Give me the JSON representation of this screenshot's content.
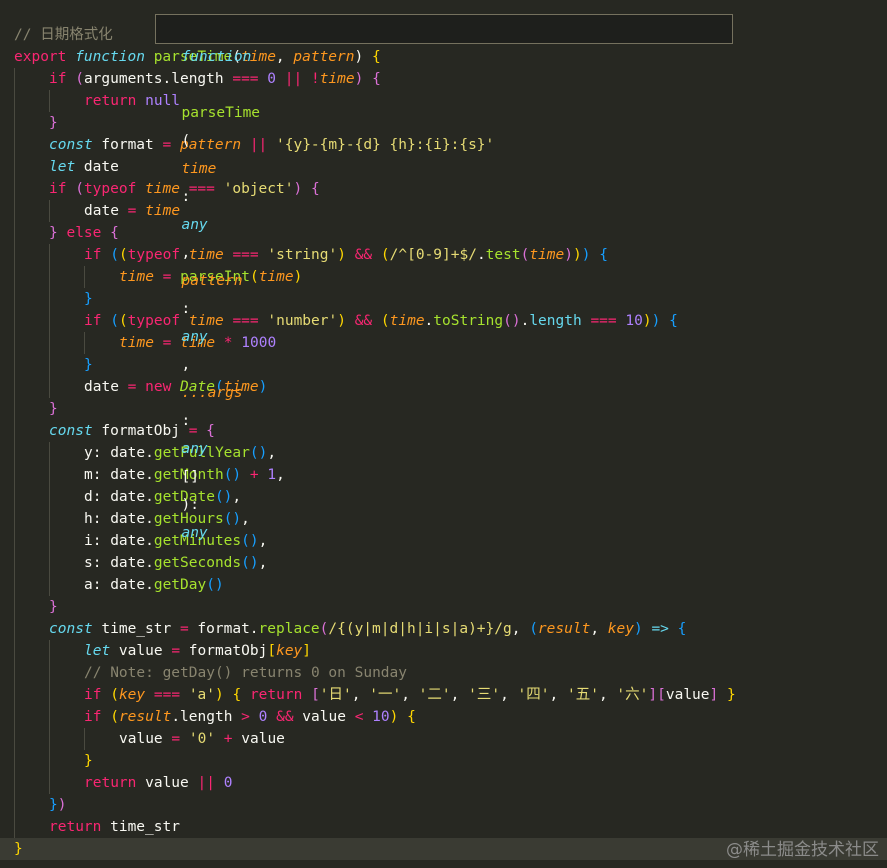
{
  "hover_tooltip": {
    "keyword": "function",
    "name": "parseTime",
    "open": "(",
    "p1": "time",
    "colon1": ": ",
    "t1": "any",
    "comma1": ", ",
    "p2": "pattern",
    "colon2": ": ",
    "t2": "any",
    "comma2": ", ",
    "p3": "...args",
    "colon3": ": ",
    "t3": "any",
    "arr": "[]",
    "close": "): ",
    "ret": "any"
  },
  "code_lines": [
    {
      "indent": 0,
      "tokens": [
        [
          "cm",
          "// 日期格式化"
        ]
      ]
    },
    {
      "indent": 0,
      "tokens": [
        [
          "kw",
          "export "
        ],
        [
          "st",
          "function "
        ],
        [
          "fn",
          "parseTime"
        ],
        [
          "br1",
          "("
        ],
        [
          "pa",
          "time"
        ],
        [
          "tx",
          ", "
        ],
        [
          "pa",
          "pattern"
        ],
        [
          "br1",
          ") "
        ],
        [
          "brY",
          "{"
        ]
      ]
    },
    {
      "indent": 1,
      "tokens": [
        [
          "kw",
          "if "
        ],
        [
          "brP",
          "("
        ],
        [
          "tx",
          "arguments.length "
        ],
        [
          "pu",
          "==="
        ],
        [
          "tx",
          " "
        ],
        [
          "num",
          "0"
        ],
        [
          "tx",
          " "
        ],
        [
          "pu",
          "||"
        ],
        [
          "tx",
          " "
        ],
        [
          "pu",
          "!"
        ],
        [
          "pa",
          "time"
        ],
        [
          "brP",
          ")"
        ],
        [
          "tx",
          " "
        ],
        [
          "brP",
          "{"
        ]
      ]
    },
    {
      "indent": 2,
      "tokens": [
        [
          "kw",
          "return "
        ],
        [
          "num",
          "null"
        ]
      ]
    },
    {
      "indent": 1,
      "tokens": [
        [
          "brP",
          "}"
        ]
      ]
    },
    {
      "indent": 1,
      "tokens": [
        [
          "st",
          "const "
        ],
        [
          "tx",
          "format "
        ],
        [
          "pu",
          "="
        ],
        [
          "tx",
          " "
        ],
        [
          "pa",
          "pattern"
        ],
        [
          "tx",
          " "
        ],
        [
          "pu",
          "||"
        ],
        [
          "tx",
          " "
        ],
        [
          "str",
          "'{y}-{m}-{d} {h}:{i}:{s}'"
        ]
      ]
    },
    {
      "indent": 1,
      "tokens": [
        [
          "st",
          "let "
        ],
        [
          "tx",
          "date"
        ]
      ]
    },
    {
      "indent": 1,
      "tokens": [
        [
          "kw",
          "if "
        ],
        [
          "brP",
          "("
        ],
        [
          "kw",
          "typeof "
        ],
        [
          "pa",
          "time"
        ],
        [
          "tx",
          " "
        ],
        [
          "pu",
          "==="
        ],
        [
          "tx",
          " "
        ],
        [
          "str",
          "'object'"
        ],
        [
          "brP",
          ")"
        ],
        [
          "tx",
          " "
        ],
        [
          "brP",
          "{"
        ]
      ]
    },
    {
      "indent": 2,
      "tokens": [
        [
          "tx",
          "date "
        ],
        [
          "pu",
          "="
        ],
        [
          "tx",
          " "
        ],
        [
          "pa",
          "time"
        ]
      ]
    },
    {
      "indent": 1,
      "tokens": [
        [
          "brP",
          "}"
        ],
        [
          "tx",
          " "
        ],
        [
          "kw",
          "else "
        ],
        [
          "brP",
          "{"
        ]
      ]
    },
    {
      "indent": 2,
      "tokens": [
        [
          "kw",
          "if "
        ],
        [
          "brB",
          "("
        ],
        [
          "brY",
          "("
        ],
        [
          "kw",
          "typeof "
        ],
        [
          "pa",
          "time"
        ],
        [
          "tx",
          " "
        ],
        [
          "pu",
          "==="
        ],
        [
          "tx",
          " "
        ],
        [
          "str",
          "'string'"
        ],
        [
          "brY",
          ")"
        ],
        [
          "tx",
          " "
        ],
        [
          "pu",
          "&&"
        ],
        [
          "tx",
          " "
        ],
        [
          "brY",
          "("
        ],
        [
          "rx",
          "/^[0-9]+$/"
        ],
        [
          "tx",
          "."
        ],
        [
          "fn",
          "test"
        ],
        [
          "brP",
          "("
        ],
        [
          "pa",
          "time"
        ],
        [
          "brP",
          ")"
        ],
        [
          "brY",
          ")"
        ],
        [
          "brB",
          ")"
        ],
        [
          "tx",
          " "
        ],
        [
          "brB",
          "{"
        ]
      ]
    },
    {
      "indent": 3,
      "tokens": [
        [
          "pa",
          "time"
        ],
        [
          "tx",
          " "
        ],
        [
          "pu",
          "="
        ],
        [
          "tx",
          " "
        ],
        [
          "fn",
          "parseInt"
        ],
        [
          "brY",
          "("
        ],
        [
          "pa",
          "time"
        ],
        [
          "brY",
          ")"
        ]
      ]
    },
    {
      "indent": 2,
      "tokens": [
        [
          "brB",
          "}"
        ]
      ]
    },
    {
      "indent": 2,
      "tokens": [
        [
          "kw",
          "if "
        ],
        [
          "brB",
          "("
        ],
        [
          "brY",
          "("
        ],
        [
          "kw",
          "typeof "
        ],
        [
          "pa",
          "time"
        ],
        [
          "tx",
          " "
        ],
        [
          "pu",
          "==="
        ],
        [
          "tx",
          " "
        ],
        [
          "str",
          "'number'"
        ],
        [
          "brY",
          ")"
        ],
        [
          "tx",
          " "
        ],
        [
          "pu",
          "&&"
        ],
        [
          "tx",
          " "
        ],
        [
          "brY",
          "("
        ],
        [
          "pa",
          "time"
        ],
        [
          "tx",
          "."
        ],
        [
          "fn",
          "toString"
        ],
        [
          "brP",
          "()"
        ],
        [
          "tx",
          "."
        ],
        [
          "meth",
          "length"
        ],
        [
          "tx",
          " "
        ],
        [
          "pu",
          "==="
        ],
        [
          "tx",
          " "
        ],
        [
          "num",
          "10"
        ],
        [
          "brY",
          ")"
        ],
        [
          "brB",
          ")"
        ],
        [
          "tx",
          " "
        ],
        [
          "brB",
          "{"
        ]
      ]
    },
    {
      "indent": 3,
      "tokens": [
        [
          "pa",
          "time"
        ],
        [
          "tx",
          " "
        ],
        [
          "pu",
          "="
        ],
        [
          "tx",
          " "
        ],
        [
          "pa",
          "time"
        ],
        [
          "tx",
          " "
        ],
        [
          "pu",
          "*"
        ],
        [
          "tx",
          " "
        ],
        [
          "num",
          "1000"
        ]
      ]
    },
    {
      "indent": 2,
      "tokens": [
        [
          "brB",
          "}"
        ]
      ]
    },
    {
      "indent": 2,
      "tokens": [
        [
          "tx",
          "date "
        ],
        [
          "pu",
          "="
        ],
        [
          "tx",
          " "
        ],
        [
          "kw",
          "new "
        ],
        [
          "cls",
          "Date"
        ],
        [
          "brB",
          "("
        ],
        [
          "pa",
          "time"
        ],
        [
          "brB",
          ")"
        ]
      ]
    },
    {
      "indent": 1,
      "tokens": [
        [
          "brP",
          "}"
        ]
      ]
    },
    {
      "indent": 1,
      "tokens": [
        [
          "st",
          "const "
        ],
        [
          "tx",
          "formatObj "
        ],
        [
          "pu",
          "="
        ],
        [
          "tx",
          " "
        ],
        [
          "brP",
          "{"
        ]
      ]
    },
    {
      "indent": 2,
      "tokens": [
        [
          "tx",
          "y: date."
        ],
        [
          "fn",
          "getFullYear"
        ],
        [
          "brB",
          "()"
        ],
        [
          "tx",
          ","
        ]
      ]
    },
    {
      "indent": 2,
      "tokens": [
        [
          "tx",
          "m: date."
        ],
        [
          "fn",
          "getMonth"
        ],
        [
          "brB",
          "()"
        ],
        [
          "tx",
          " "
        ],
        [
          "pu",
          "+"
        ],
        [
          "tx",
          " "
        ],
        [
          "num",
          "1"
        ],
        [
          "tx",
          ","
        ]
      ]
    },
    {
      "indent": 2,
      "tokens": [
        [
          "tx",
          "d: date."
        ],
        [
          "fn",
          "getDate"
        ],
        [
          "brB",
          "()"
        ],
        [
          "tx",
          ","
        ]
      ]
    },
    {
      "indent": 2,
      "tokens": [
        [
          "tx",
          "h: date."
        ],
        [
          "fn",
          "getHours"
        ],
        [
          "brB",
          "()"
        ],
        [
          "tx",
          ","
        ]
      ]
    },
    {
      "indent": 2,
      "tokens": [
        [
          "tx",
          "i: date."
        ],
        [
          "fn",
          "getMinutes"
        ],
        [
          "brB",
          "()"
        ],
        [
          "tx",
          ","
        ]
      ]
    },
    {
      "indent": 2,
      "tokens": [
        [
          "tx",
          "s: date."
        ],
        [
          "fn",
          "getSeconds"
        ],
        [
          "brB",
          "()"
        ],
        [
          "tx",
          ","
        ]
      ]
    },
    {
      "indent": 2,
      "tokens": [
        [
          "tx",
          "a: date."
        ],
        [
          "fn",
          "getDay"
        ],
        [
          "brB",
          "()"
        ]
      ]
    },
    {
      "indent": 1,
      "tokens": [
        [
          "brP",
          "}"
        ]
      ]
    },
    {
      "indent": 1,
      "tokens": [
        [
          "st",
          "const "
        ],
        [
          "tx",
          "time_str "
        ],
        [
          "pu",
          "="
        ],
        [
          "tx",
          " format."
        ],
        [
          "fn",
          "replace"
        ],
        [
          "brP",
          "("
        ],
        [
          "rx",
          "/{(y|m|d|h|i|s|a)+}/g"
        ],
        [
          "tx",
          ", "
        ],
        [
          "brB",
          "("
        ],
        [
          "pa",
          "result"
        ],
        [
          "tx",
          ", "
        ],
        [
          "pa",
          "key"
        ],
        [
          "brB",
          ")"
        ],
        [
          "tx",
          " "
        ],
        [
          "st",
          "=>"
        ],
        [
          "tx",
          " "
        ],
        [
          "brB",
          "{"
        ]
      ]
    },
    {
      "indent": 2,
      "tokens": [
        [
          "st",
          "let "
        ],
        [
          "tx",
          "value "
        ],
        [
          "pu",
          "="
        ],
        [
          "tx",
          " formatObj"
        ],
        [
          "brY",
          "["
        ],
        [
          "pa",
          "key"
        ],
        [
          "brY",
          "]"
        ]
      ]
    },
    {
      "indent": 2,
      "tokens": [
        [
          "cm",
          "// Note: getDay() returns 0 on Sunday"
        ]
      ]
    },
    {
      "indent": 2,
      "tokens": [
        [
          "kw",
          "if "
        ],
        [
          "brY",
          "("
        ],
        [
          "pa",
          "key"
        ],
        [
          "tx",
          " "
        ],
        [
          "pu",
          "==="
        ],
        [
          "tx",
          " "
        ],
        [
          "str",
          "'a'"
        ],
        [
          "brY",
          ")"
        ],
        [
          "tx",
          " "
        ],
        [
          "brY",
          "{"
        ],
        [
          "tx",
          " "
        ],
        [
          "kw",
          "return "
        ],
        [
          "brP",
          "["
        ],
        [
          "str",
          "'日'"
        ],
        [
          "tx",
          ", "
        ],
        [
          "str",
          "'一'"
        ],
        [
          "tx",
          ", "
        ],
        [
          "str",
          "'二'"
        ],
        [
          "tx",
          ", "
        ],
        [
          "str",
          "'三'"
        ],
        [
          "tx",
          ", "
        ],
        [
          "str",
          "'四'"
        ],
        [
          "tx",
          ", "
        ],
        [
          "str",
          "'五'"
        ],
        [
          "tx",
          ", "
        ],
        [
          "str",
          "'六'"
        ],
        [
          "brP",
          "]"
        ],
        [
          "brP",
          "["
        ],
        [
          "tx",
          "value"
        ],
        [
          "brP",
          "]"
        ],
        [
          "tx",
          " "
        ],
        [
          "brY",
          "}"
        ]
      ]
    },
    {
      "indent": 2,
      "tokens": [
        [
          "kw",
          "if "
        ],
        [
          "brY",
          "("
        ],
        [
          "pa",
          "result"
        ],
        [
          "tx",
          ".length "
        ],
        [
          "pu",
          ">"
        ],
        [
          "tx",
          " "
        ],
        [
          "num",
          "0"
        ],
        [
          "tx",
          " "
        ],
        [
          "pu",
          "&&"
        ],
        [
          "tx",
          " value "
        ],
        [
          "pu",
          "<"
        ],
        [
          "tx",
          " "
        ],
        [
          "num",
          "10"
        ],
        [
          "brY",
          ")"
        ],
        [
          "tx",
          " "
        ],
        [
          "brY",
          "{"
        ]
      ]
    },
    {
      "indent": 3,
      "tokens": [
        [
          "tx",
          "value "
        ],
        [
          "pu",
          "="
        ],
        [
          "tx",
          " "
        ],
        [
          "str",
          "'0'"
        ],
        [
          "tx",
          " "
        ],
        [
          "pu",
          "+"
        ],
        [
          "tx",
          " value"
        ]
      ]
    },
    {
      "indent": 2,
      "tokens": [
        [
          "brY",
          "}"
        ]
      ]
    },
    {
      "indent": 2,
      "tokens": [
        [
          "kw",
          "return "
        ],
        [
          "tx",
          "value "
        ],
        [
          "pu",
          "||"
        ],
        [
          "tx",
          " "
        ],
        [
          "num",
          "0"
        ]
      ]
    },
    {
      "indent": 1,
      "tokens": [
        [
          "brB",
          "}"
        ],
        [
          "brP",
          ")"
        ]
      ]
    },
    {
      "indent": 1,
      "tokens": [
        [
          "kw",
          "return "
        ],
        [
          "tx",
          "time_str"
        ]
      ]
    },
    {
      "indent": 0,
      "current": true,
      "tokens": [
        [
          "brY",
          "}"
        ]
      ]
    }
  ],
  "watermark": "@稀土掘金技术社区"
}
